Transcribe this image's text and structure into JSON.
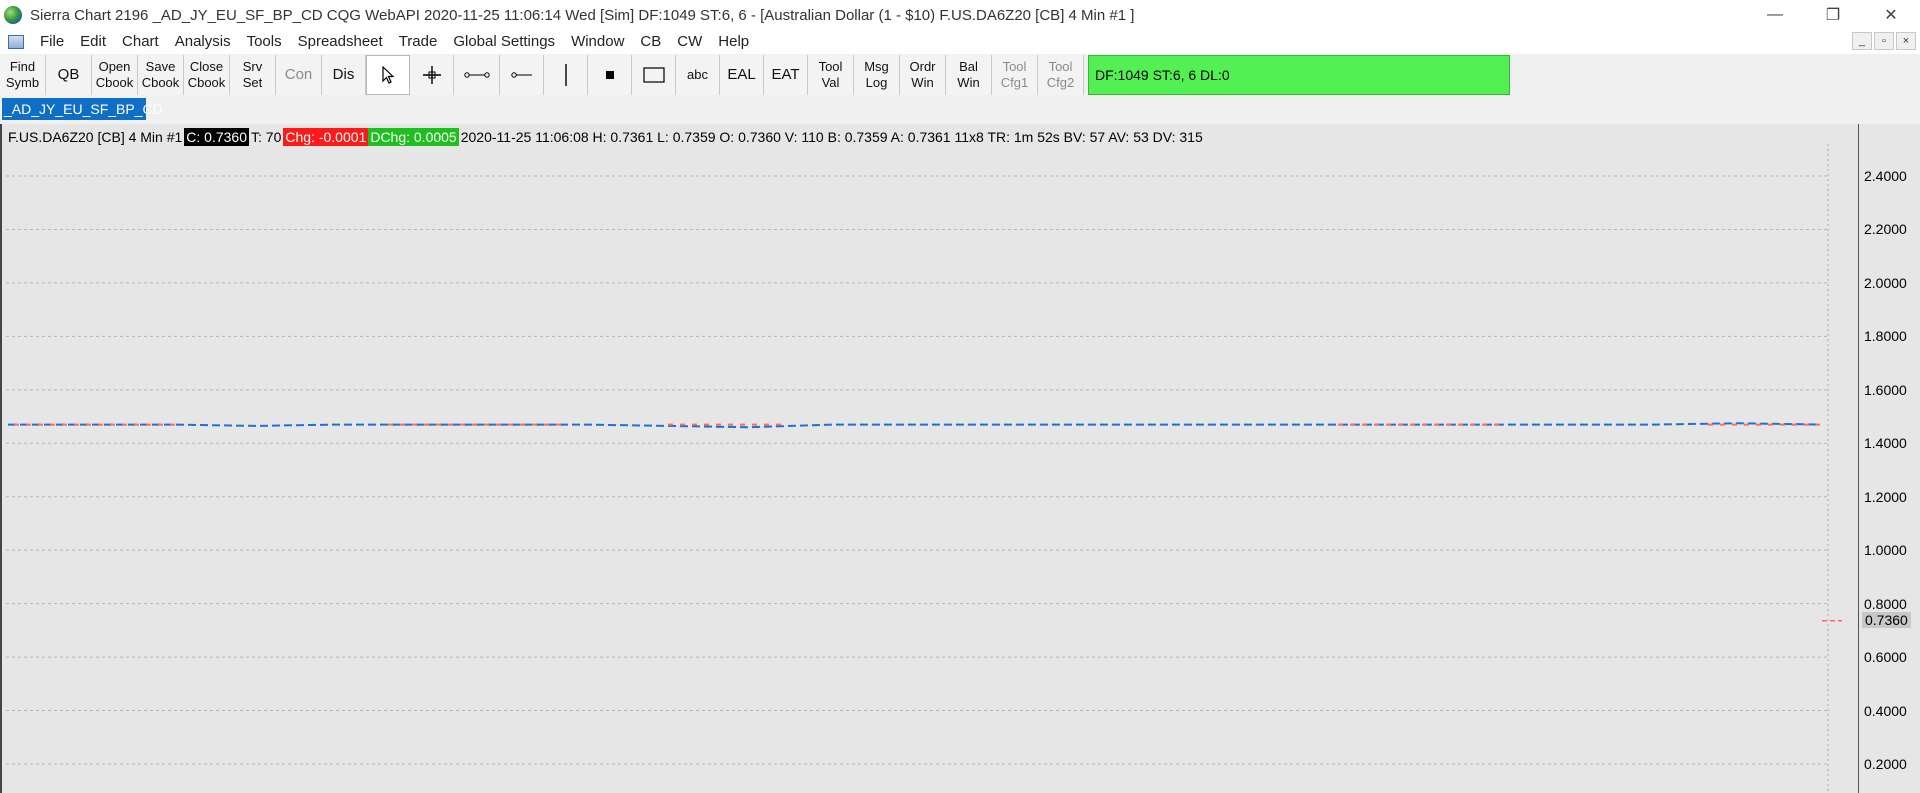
{
  "window": {
    "title": "Sierra Chart 2196 _AD_JY_EU_SF_BP_CD  CQG WebAPI 2020-11-25  11:06:14 Wed [Sim]  DF:1049  ST:6, 6 - [Australian Dollar (1 - $10) F.US.DA6Z20 [CB]  4 Min   #1 ]",
    "controls": [
      "—",
      "❐",
      "✕"
    ]
  },
  "menu": {
    "items": [
      "File",
      "Edit",
      "Chart",
      "Analysis",
      "Tools",
      "Spreadsheet",
      "Trade",
      "Global Settings",
      "Window",
      "CB",
      "CW",
      "Help"
    ],
    "mdi_controls": [
      "_",
      "▫",
      "×"
    ]
  },
  "toolbar": {
    "buttons": [
      {
        "line1": "Find",
        "line2": "Symb"
      },
      {
        "line1": "QB",
        "line2": ""
      },
      {
        "line1": "Open",
        "line2": "Cbook"
      },
      {
        "line1": "Save",
        "line2": "Cbook"
      },
      {
        "line1": "Close",
        "line2": "Cbook"
      },
      {
        "line1": "Srv",
        "line2": "Set"
      },
      {
        "line1": "Con",
        "line2": ""
      },
      {
        "line1": "Dis",
        "line2": ""
      },
      {
        "line1": "EAL",
        "line2": ""
      },
      {
        "line1": "EAT",
        "line2": ""
      },
      {
        "line1": "Tool",
        "line2": "Val"
      },
      {
        "line1": "Msg",
        "line2": "Log"
      },
      {
        "line1": "Ordr",
        "line2": "Win"
      },
      {
        "line1": "Bal",
        "line2": "Win"
      },
      {
        "line1": "Tool",
        "line2": "Cfg1"
      },
      {
        "line1": "Tool",
        "line2": "Cfg2"
      }
    ],
    "abc_label": "abc",
    "status": "DF:1049  ST:6, 6  DL:0",
    "status_color": "#52f052"
  },
  "tab": {
    "label": "_AD_JY_EU_SF_BP_CD",
    "color": "#0f6fc6"
  },
  "chart_header": {
    "symbol": "F.US.DA6Z20 [CB]  4 Min   #1",
    "close": "C: 0.7360",
    "trades": "T: 70",
    "change": "Chg: -0.0001",
    "dchange": "DChg: 0.0005",
    "details": "2020-11-25 11:06:08 H: 0.7361 L: 0.7359 O: 0.7360 V: 110 B: 0.7359 A: 0.7361 11x8 TR: 1m 52s BV: 57 AV: 53 DV: 315"
  },
  "chart_data": {
    "type": "line",
    "y_ticks": [
      "2.4000",
      "2.2000",
      "2.0000",
      "1.8000",
      "1.6000",
      "1.4000",
      "1.2000",
      "1.0000",
      "0.8000",
      "0.6000",
      "0.4000",
      "0.2000"
    ],
    "ylim": [
      0.1,
      2.5
    ],
    "last_price": "0.7360",
    "series": [
      {
        "color": "#1f6fd6",
        "values": [
          1.47,
          1.47,
          1.47,
          1.465,
          1.47,
          1.47,
          1.47,
          1.47,
          1.465,
          1.46,
          1.47,
          1.47,
          1.47,
          1.47,
          1.47,
          1.47,
          1.47,
          1.47,
          1.47,
          1.47,
          1.47,
          1.475,
          1.47
        ]
      },
      {
        "color": "#ff6a5a",
        "values": [
          0.736
        ]
      }
    ]
  }
}
